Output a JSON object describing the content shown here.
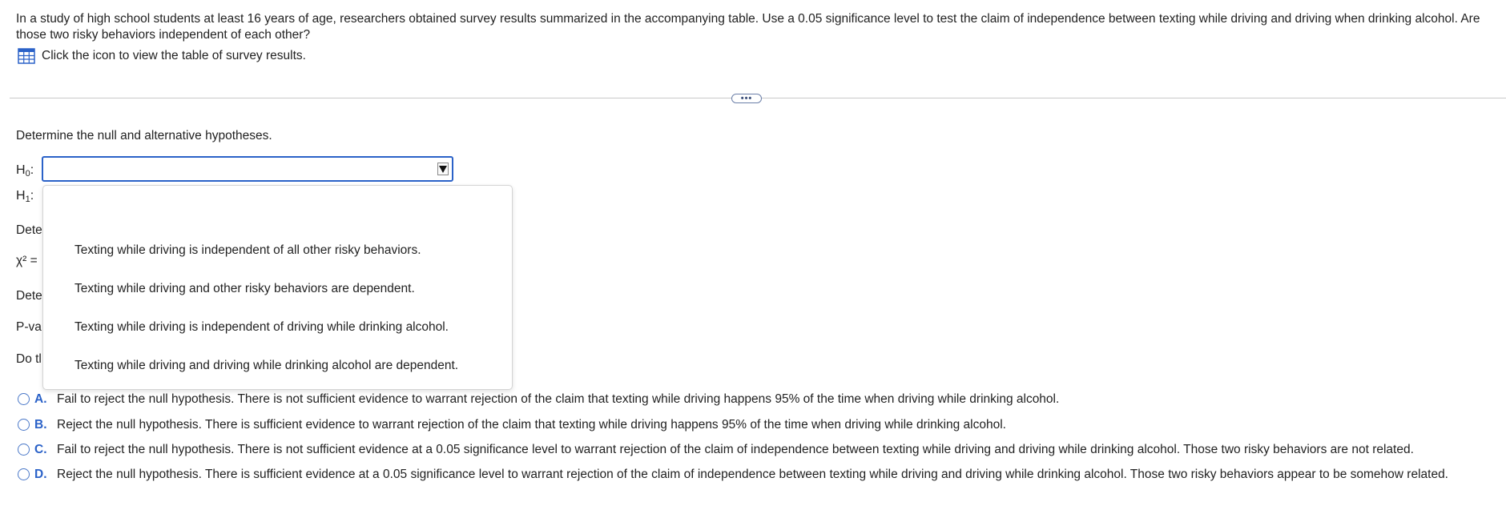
{
  "question": {
    "text": "In a study of high school students at least 16 years of age, researchers obtained survey results summarized in the accompanying table. Use a 0.05 significance level to test the claim of independence between texting while driving and driving when drinking alcohol. Are those two risky behaviors independent of each other?",
    "table_link_text": "Click the icon to view the table of survey results."
  },
  "more_button_label": "•••",
  "hypotheses": {
    "prompt": "Determine the null and alternative hypotheses.",
    "h0_label": "H",
    "h0_sub": "0",
    "h1_label": "H",
    "h1_sub": "1",
    "colon": ":",
    "selected_value": "",
    "options": [
      "Texting while driving is independent of all other risky behaviors.",
      "Texting while driving and other risky behaviors are dependent.",
      "Texting while driving is independent of driving while drinking alcohol.",
      "Texting while driving and driving while drinking alcohol are dependent."
    ]
  },
  "partial_labels": {
    "determine_1": "Dete",
    "chi_square": "χ² =",
    "determine_2": "Dete",
    "p_value": "P-va",
    "do_the": "Do tl"
  },
  "choices": [
    {
      "letter": "A.",
      "text": "Fail to reject the null hypothesis. There is not sufficient evidence to warrant rejection of the claim that texting while driving happens 95% of the time when driving while drinking alcohol."
    },
    {
      "letter": "B.",
      "text": "Reject the null hypothesis. There is sufficient evidence to warrant rejection of the claim that texting while driving happens 95% of the time when driving while drinking alcohol."
    },
    {
      "letter": "C.",
      "text": "Fail to reject the null hypothesis. There is not sufficient evidence at a 0.05 significance level to warrant rejection of the claim of independence between texting while driving and driving while drinking alcohol. Those two risky behaviors are not related."
    },
    {
      "letter": "D.",
      "text": "Reject the null hypothesis. There is sufficient evidence at a 0.05 significance level to warrant rejection of the claim of independence between texting while driving and driving while drinking alcohol. Those two risky behaviors appear to be somehow related."
    }
  ],
  "colors": {
    "accent": "#2b62c8",
    "text": "#222222",
    "divider": "#c9c9c9"
  },
  "icons": {
    "table": "table-grid-icon",
    "dropdown": "caret-down-icon"
  }
}
